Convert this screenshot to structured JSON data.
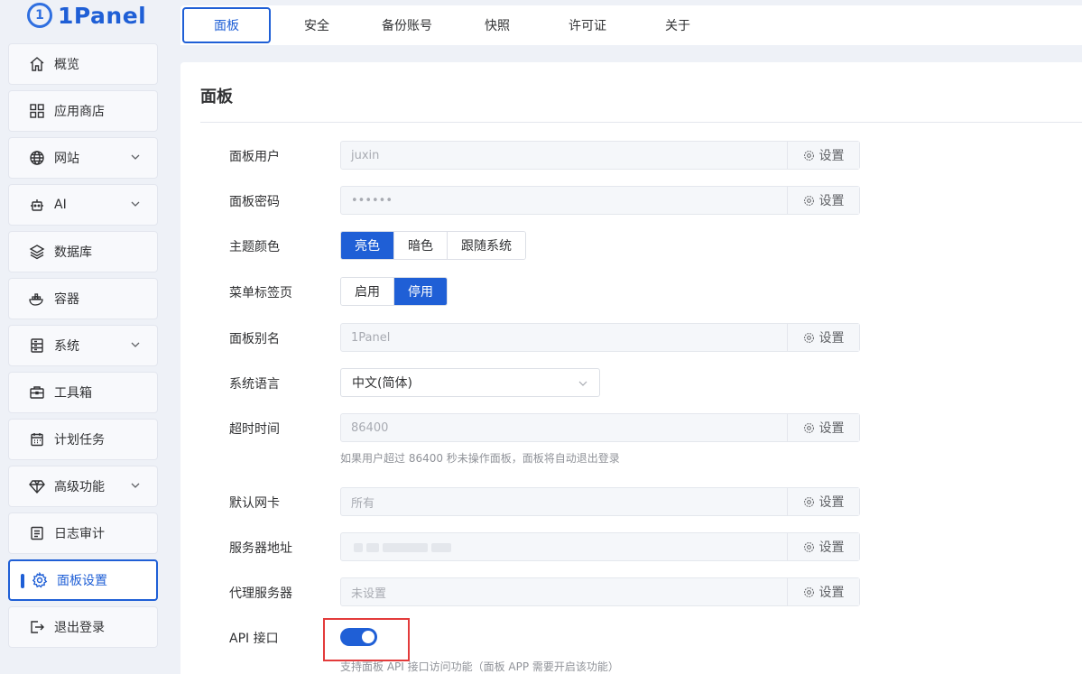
{
  "brand": {
    "name": "1Panel"
  },
  "sidebar": {
    "items": [
      {
        "label": "概览",
        "icon": "home-icon",
        "expandable": false
      },
      {
        "label": "应用商店",
        "icon": "grid-icon",
        "expandable": false
      },
      {
        "label": "网站",
        "icon": "globe-icon",
        "expandable": true
      },
      {
        "label": "AI",
        "icon": "robot-icon",
        "expandable": true
      },
      {
        "label": "数据库",
        "icon": "layers-icon",
        "expandable": false
      },
      {
        "label": "容器",
        "icon": "docker-icon",
        "expandable": false
      },
      {
        "label": "系统",
        "icon": "server-icon",
        "expandable": true
      },
      {
        "label": "工具箱",
        "icon": "toolbox-icon",
        "expandable": false
      },
      {
        "label": "计划任务",
        "icon": "calendar-icon",
        "expandable": false
      },
      {
        "label": "高级功能",
        "icon": "diamond-icon",
        "expandable": true
      },
      {
        "label": "日志审计",
        "icon": "log-icon",
        "expandable": false
      },
      {
        "label": "面板设置",
        "icon": "gear-icon",
        "expandable": false,
        "active": true
      },
      {
        "label": "退出登录",
        "icon": "logout-icon",
        "expandable": false
      }
    ]
  },
  "tabs": [
    {
      "label": "面板",
      "active": true
    },
    {
      "label": "安全"
    },
    {
      "label": "备份账号"
    },
    {
      "label": "快照"
    },
    {
      "label": "许可证"
    },
    {
      "label": "关于"
    }
  ],
  "panel": {
    "title": "面板",
    "set_label": "设置",
    "fields": {
      "user": {
        "label": "面板用户",
        "value": "juxin"
      },
      "password": {
        "label": "面板密码",
        "value": "••••••"
      },
      "theme": {
        "label": "主题颜色",
        "options": [
          "亮色",
          "暗色",
          "跟随系统"
        ],
        "selected": "亮色"
      },
      "menu_tabs": {
        "label": "菜单标签页",
        "options": [
          "启用",
          "停用"
        ],
        "selected": "停用"
      },
      "alias": {
        "label": "面板别名",
        "value": "1Panel"
      },
      "language": {
        "label": "系统语言",
        "value": "中文(简体)"
      },
      "timeout": {
        "label": "超时时间",
        "value": "86400",
        "hint": "如果用户超过 86400 秒未操作面板，面板将自动退出登录"
      },
      "nic": {
        "label": "默认网卡",
        "value": "所有"
      },
      "server_addr": {
        "label": "服务器地址",
        "value": ""
      },
      "proxy": {
        "label": "代理服务器",
        "value": "未设置"
      },
      "api": {
        "label": "API 接口",
        "enabled": true,
        "hint": "支持面板 API 接口访问功能（面板 APP 需要开启该功能）"
      }
    }
  },
  "colors": {
    "accent": "#1f5fd6",
    "highlight": "#e33b3b"
  }
}
